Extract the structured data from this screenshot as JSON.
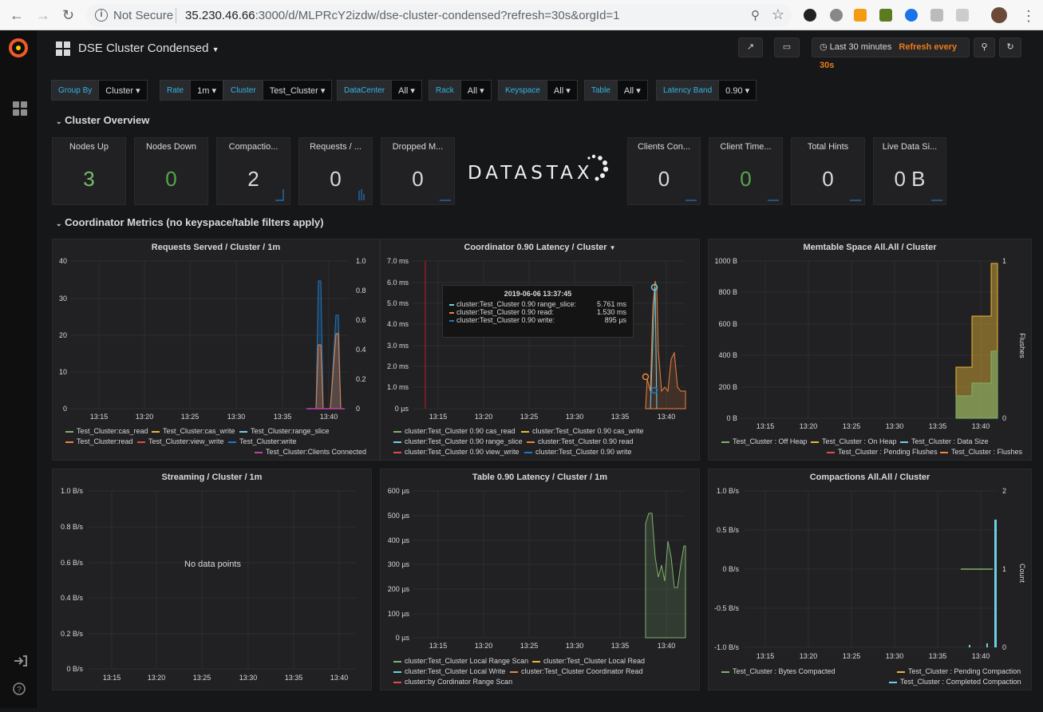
{
  "browser": {
    "not_secure": "Not Secure",
    "url_host": "35.230.46.66",
    "url_rest": ":3000/d/MLPRcY2izdw/dse-cluster-condensed?refresh=30s&orgId=1"
  },
  "dashboard": {
    "title": "DSE Cluster Condensed",
    "time_range": "Last 30 minutes",
    "refresh": "Refresh every 30s"
  },
  "variables": [
    {
      "label": "Group By",
      "value": "Cluster"
    },
    {
      "label": "Rate",
      "value": "1m"
    },
    {
      "label": "Cluster",
      "value": "Test_Cluster"
    },
    {
      "label": "DataCenter",
      "value": "All"
    },
    {
      "label": "Rack",
      "value": "All"
    },
    {
      "label": "Keyspace",
      "value": "All"
    },
    {
      "label": "Table",
      "value": "All"
    },
    {
      "label": "Latency Band",
      "value": "0.90"
    }
  ],
  "rows": {
    "overview": "Cluster Overview",
    "coordinator": "Coordinator Metrics (no keyspace/table filters apply)"
  },
  "logo": "DATASTAX",
  "stats": [
    {
      "title": "Nodes Up",
      "value": "3",
      "color": "#73bf69"
    },
    {
      "title": "Nodes Down",
      "value": "0",
      "color": "#56a64b"
    },
    {
      "title": "Compactio...",
      "value": "2",
      "color": "#d8d9da"
    },
    {
      "title": "Requests / ...",
      "value": "0",
      "color": "#d8d9da"
    },
    {
      "title": "Dropped M...",
      "value": "0",
      "color": "#d8d9da"
    },
    {
      "title": "Clients Con...",
      "value": "0",
      "color": "#d8d9da"
    },
    {
      "title": "Client Time...",
      "value": "0",
      "color": "#56a64b"
    },
    {
      "title": "Total Hints",
      "value": "0",
      "color": "#d8d9da"
    },
    {
      "title": "Live Data Si...",
      "value": "0 B",
      "color": "#d8d9da"
    }
  ],
  "time_ticks": [
    "13:15",
    "13:20",
    "13:25",
    "13:30",
    "13:35",
    "13:40"
  ],
  "panels": [
    {
      "title": "Requests Served / Cluster / 1m",
      "y_left": [
        "40",
        "30",
        "20",
        "10",
        "0"
      ],
      "y_right": [
        "1.0",
        "0.8",
        "0.6",
        "0.4",
        "0.2",
        "0"
      ],
      "legend": [
        {
          "t": "Test_Cluster:cas_read",
          "c": "#7eb26d"
        },
        {
          "t": "Test_Cluster:cas_write",
          "c": "#eab839"
        },
        {
          "t": "Test_Cluster:range_slice",
          "c": "#6ed0e0"
        },
        {
          "t": "Test_Cluster:read",
          "c": "#ef843c"
        },
        {
          "t": "Test_Cluster:view_write",
          "c": "#e24d42"
        },
        {
          "t": "Test_Cluster:write",
          "c": "#1f78c1"
        },
        {
          "t": "Test_Cluster:Clients Connected",
          "c": "#ba43a9"
        }
      ]
    },
    {
      "title": "Coordinator 0.90 Latency / Cluster",
      "y_left": [
        "7.0 ms",
        "6.0 ms",
        "5.0 ms",
        "4.0 ms",
        "3.0 ms",
        "2.0 ms",
        "1.0 ms",
        "0 µs"
      ],
      "legend": [
        {
          "t": "cluster:Test_Cluster 0.90 cas_read",
          "c": "#7eb26d"
        },
        {
          "t": "cluster:Test_Cluster 0.90 cas_write",
          "c": "#eab839"
        },
        {
          "t": "cluster:Test_Cluster 0.90 range_slice",
          "c": "#6ed0e0"
        },
        {
          "t": "cluster:Test_Cluster 0.90 read",
          "c": "#ef843c"
        },
        {
          "t": "cluster:Test_Cluster 0.90 view_write",
          "c": "#e24d42"
        },
        {
          "t": "cluster:Test_Cluster 0.90 write",
          "c": "#1f78c1"
        }
      ],
      "tooltip": {
        "time": "2019-06-06 13:37:45",
        "rows": [
          {
            "k": "cluster:Test_Cluster 0.90 range_slice:",
            "v": "5.761 ms",
            "c": "#6ed0e0"
          },
          {
            "k": "cluster:Test_Cluster 0.90 read:",
            "v": "1.530 ms",
            "c": "#ef843c"
          },
          {
            "k": "cluster:Test_Cluster 0.90 write:",
            "v": "895 µs",
            "c": "#1f78c1"
          }
        ]
      }
    },
    {
      "title": "Memtable Space All.All / Cluster",
      "y_left": [
        "1000 B",
        "800 B",
        "600 B",
        "400 B",
        "200 B",
        "0 B"
      ],
      "y_right": [
        "1",
        "0"
      ],
      "y_right_label": "Flushes",
      "legend": [
        {
          "t": "Test_Cluster : Off Heap",
          "c": "#7eb26d"
        },
        {
          "t": "Test_Cluster : On Heap",
          "c": "#eab839"
        },
        {
          "t": "Test_Cluster : Data Size",
          "c": "#6ed0e0"
        },
        {
          "t": "Test_Cluster : Pending Flushes",
          "c": "#e24d42"
        },
        {
          "t": "Test_Cluster : Flushes",
          "c": "#ef843c"
        }
      ]
    },
    {
      "title": "Streaming / Cluster / 1m",
      "y_left": [
        "1.0 B/s",
        "0.8 B/s",
        "0.6 B/s",
        "0.4 B/s",
        "0.2 B/s",
        "0 B/s"
      ],
      "no_data": "No data points"
    },
    {
      "title": "Table 0.90 Latency / Cluster / 1m",
      "y_left": [
        "600 µs",
        "500 µs",
        "400 µs",
        "300 µs",
        "200 µs",
        "100 µs",
        "0 µs"
      ],
      "legend": [
        {
          "t": "cluster:Test_Cluster Local Range Scan",
          "c": "#7eb26d"
        },
        {
          "t": "cluster:Test_Cluster Local Read",
          "c": "#eab839"
        },
        {
          "t": "cluster:Test_Cluster Local Write",
          "c": "#6ed0e0"
        },
        {
          "t": "cluster:Test_Cluster Coordinator Read",
          "c": "#ef843c"
        },
        {
          "t": "cluster:by Cordinator Range Scan",
          "c": "#e24d42"
        }
      ]
    },
    {
      "title": "Compactions All.All / Cluster",
      "y_left": [
        "1.0 B/s",
        "0.5 B/s",
        "0 B/s",
        "-0.5 B/s",
        "-1.0 B/s"
      ],
      "y_right": [
        "2",
        "1",
        "0"
      ],
      "y_right_label": "Count",
      "legend": [
        {
          "t": "Test_Cluster : Bytes Compacted",
          "c": "#7eb26d"
        },
        {
          "t": "Test_Cluster : Pending Compaction",
          "c": "#eab839"
        },
        {
          "t": "Test_Cluster : Completed Compaction",
          "c": "#6ed0e0"
        }
      ]
    }
  ]
}
